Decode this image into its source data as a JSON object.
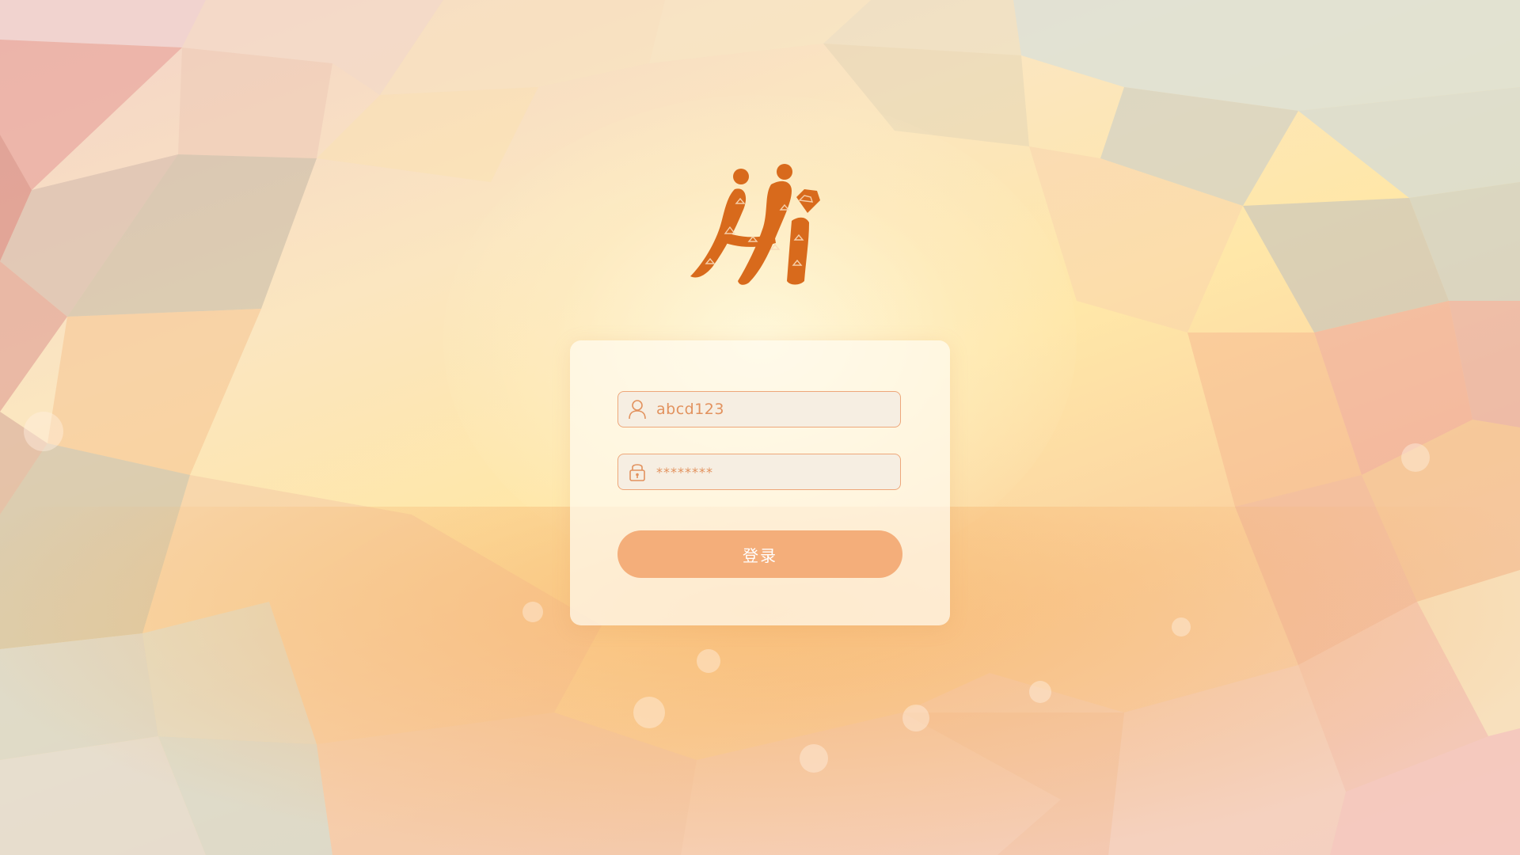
{
  "login_form": {
    "username_value": "abcd123",
    "password_value": "********",
    "submit_label": "登录"
  },
  "icons": {
    "username": "user-icon",
    "password": "lock-icon",
    "logo": "hi-logo"
  },
  "colors": {
    "accent": "#f4ae7a",
    "field_border": "#eea77a",
    "field_text": "#e2925e",
    "logo": "#d86a1c"
  }
}
